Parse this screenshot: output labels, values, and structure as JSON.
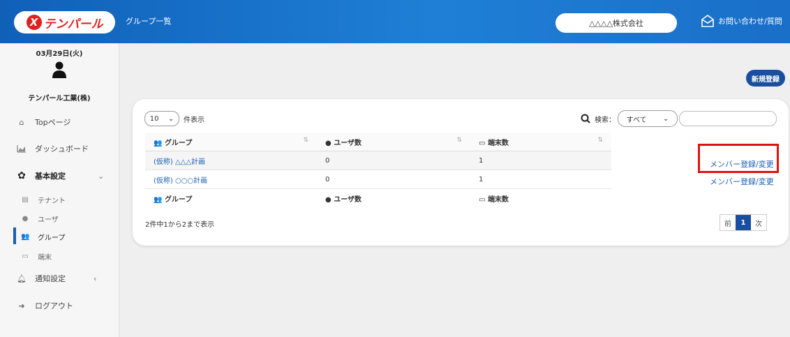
{
  "header": {
    "logo_text": "テンパール",
    "logo_mark": "X",
    "page_title": "グループ一覧",
    "company": "△△△△株式会社",
    "contact": "お問い合わせ/質問"
  },
  "sidebar": {
    "date": "03月29日(火)",
    "user_name": "テンパール工業(株)",
    "items": [
      {
        "label": "Topページ",
        "icon": "home-icon"
      },
      {
        "label": "ダッシュボード",
        "icon": "chart-area-icon"
      },
      {
        "label": "基本設定",
        "icon": "gear-icon",
        "chevron": "⌄"
      },
      {
        "label": "テナント",
        "icon": "building-icon"
      },
      {
        "label": "ユーザ",
        "icon": "user-icon"
      },
      {
        "label": "グループ",
        "icon": "users-icon"
      },
      {
        "label": "端末",
        "icon": "laptop-icon"
      },
      {
        "label": "通知設定",
        "icon": "bell-icon",
        "chevron": "‹"
      },
      {
        "label": "ログアウト",
        "icon": "sign-out-icon"
      }
    ]
  },
  "toolbar": {
    "new_button": "新規登録"
  },
  "table_controls": {
    "length_value": "10",
    "length_label": "件表示",
    "search_label": "検索：",
    "filter_value": "すべて"
  },
  "table": {
    "columns": [
      "グループ",
      "ユーザ数",
      "端末数"
    ],
    "rows": [
      {
        "group": "(仮称) △△△計画",
        "users": "0",
        "devices": "1",
        "action": "メンバー登録/変更"
      },
      {
        "group": "(仮称) ○○○計画",
        "users": "0",
        "devices": "1",
        "action": "メンバー登録/変更"
      }
    ]
  },
  "footer": {
    "info": "2件中1から2まで表示",
    "prev": "前",
    "page": "1",
    "next": "次"
  }
}
